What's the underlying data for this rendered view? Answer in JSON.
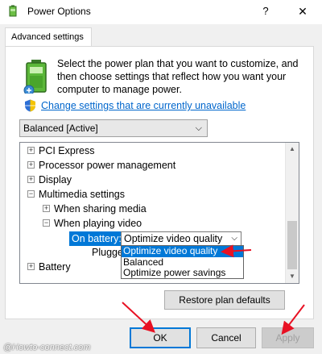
{
  "window": {
    "title": "Power Options",
    "help_glyph": "?",
    "close_glyph": "✕"
  },
  "tab": {
    "label": "Advanced settings"
  },
  "description": "Select the power plan that you want to customize, and then choose settings that reflect how you want your computer to manage power.",
  "change_link": "Change settings that are currently unavailable",
  "plan_select": {
    "value": "Balanced [Active]",
    "chevron": "⌵"
  },
  "tree": {
    "items": [
      {
        "label": "PCI Express",
        "expander": "+"
      },
      {
        "label": "Processor power management",
        "expander": "+"
      },
      {
        "label": "Display",
        "expander": "+"
      },
      {
        "label": "Multimedia settings",
        "expander": "−"
      },
      {
        "label": "When sharing media",
        "expander": "+"
      },
      {
        "label": "When playing video",
        "expander": "−"
      },
      {
        "label": "Battery",
        "expander": "+"
      }
    ],
    "on_battery_label": "On battery:",
    "on_battery_value": "Optimize video quality",
    "plugged_in_label": "Plugged in:",
    "dropdown_options": [
      "Optimize video quality",
      "Balanced",
      "Optimize power savings"
    ],
    "scroll_up": "▲",
    "scroll_down": "▼"
  },
  "buttons": {
    "restore": "Restore plan defaults",
    "ok": "OK",
    "cancel": "Cancel",
    "apply": "Apply"
  },
  "watermark": "@Howto-connect.com",
  "colors": {
    "accent": "#0078d7",
    "annotation_arrow": "#e81123",
    "link": "#0066cc"
  }
}
